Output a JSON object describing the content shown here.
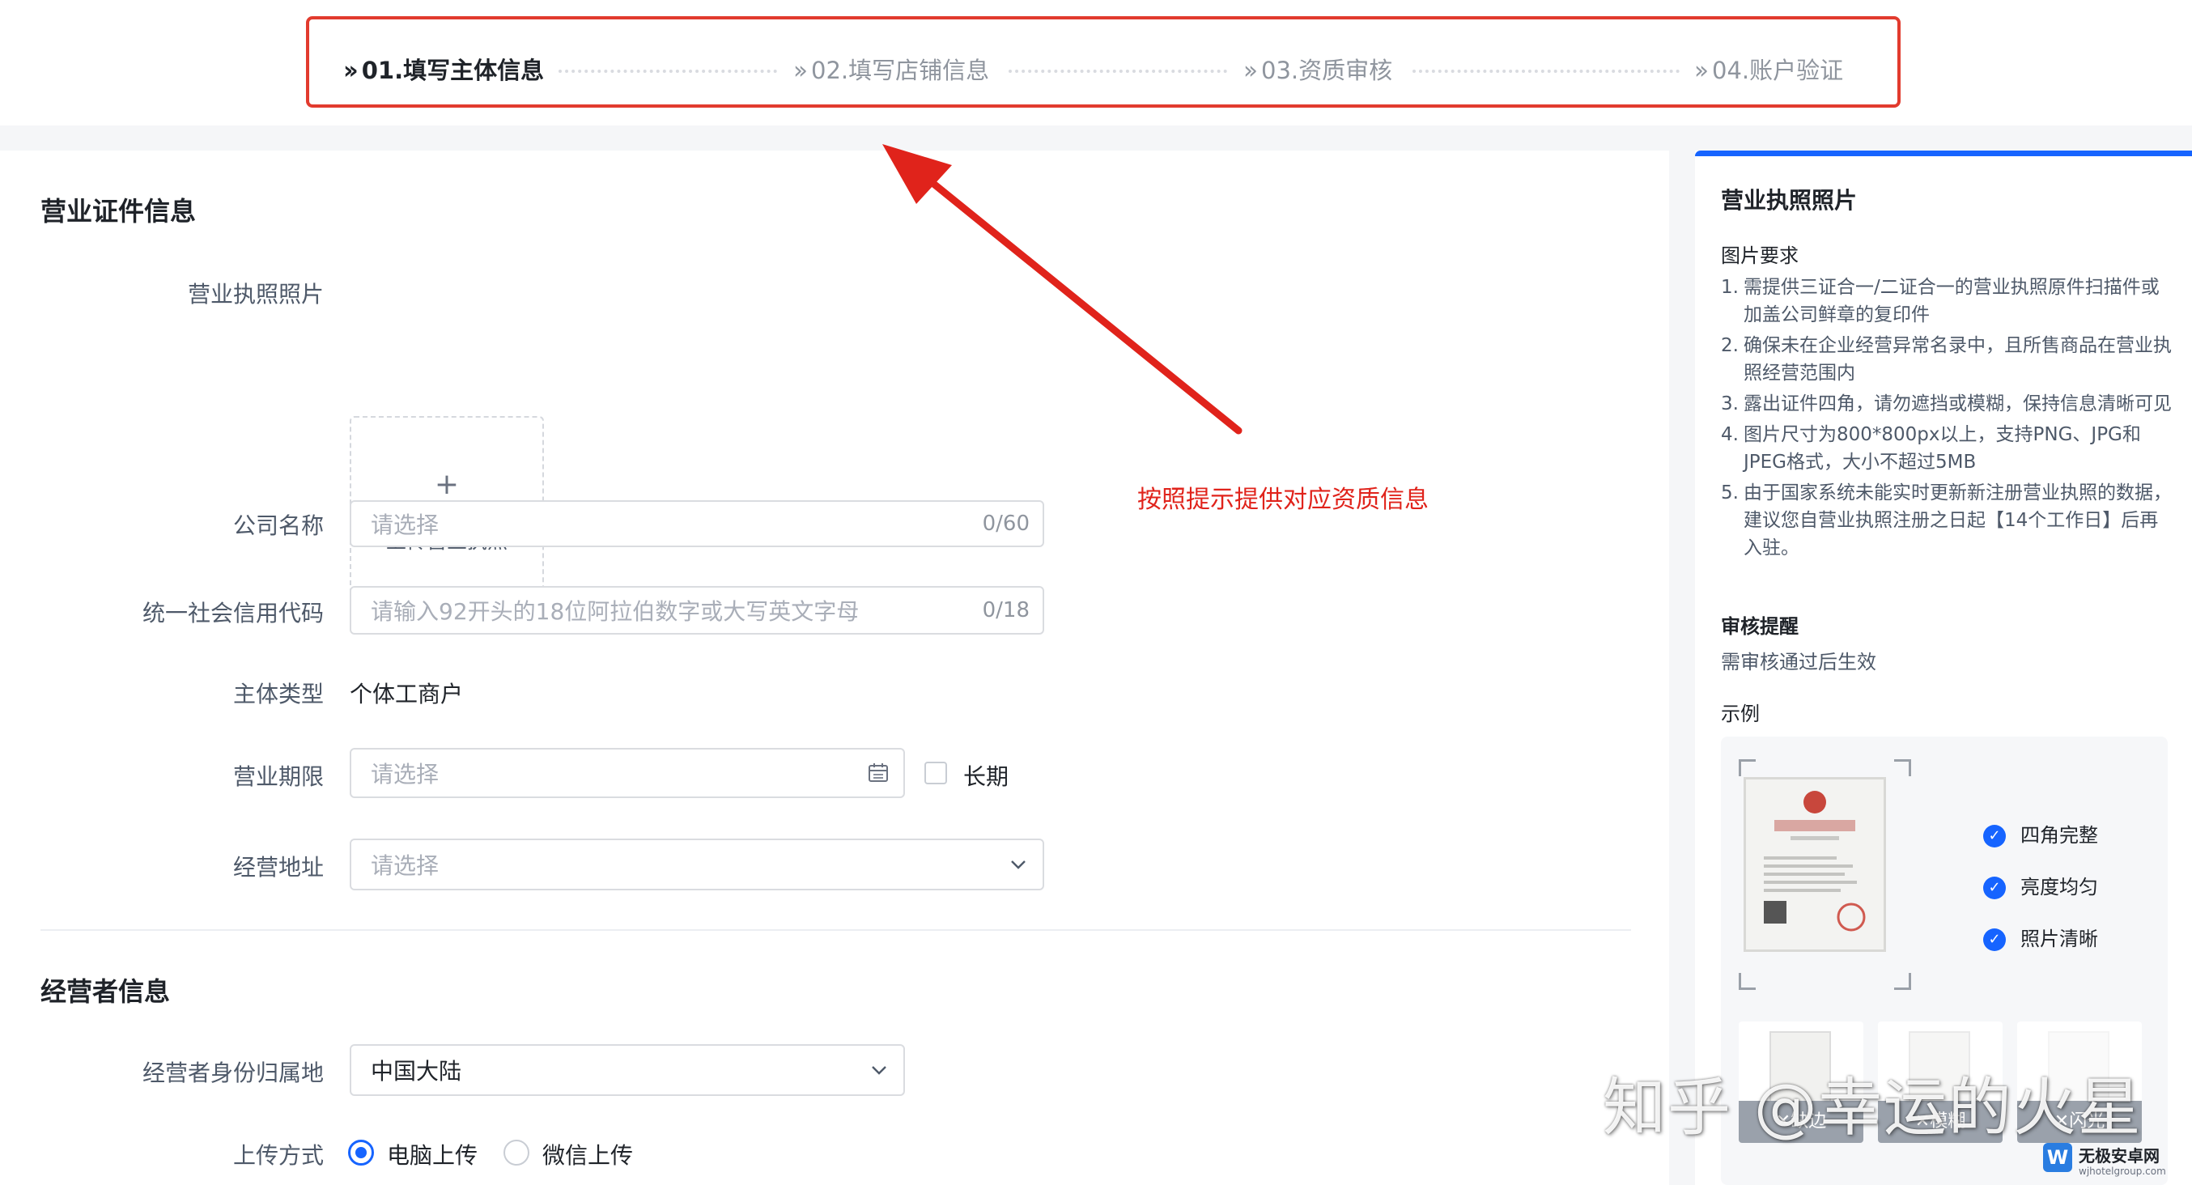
{
  "steps": [
    {
      "label": "01.填写主体信息",
      "active": true
    },
    {
      "label": "02.填写店铺信息",
      "active": false
    },
    {
      "label": "03.资质审核",
      "active": false
    },
    {
      "label": "04.账户验证",
      "active": false
    }
  ],
  "annotation": "按照提示提供对应资质信息",
  "license_section": {
    "title": "营业证件信息",
    "photo_label": "营业执照照片",
    "upload_plus": "+",
    "upload_text": "上传营业执照",
    "company_name": {
      "label": "公司名称",
      "placeholder": "请选择",
      "count": "0/60"
    },
    "credit_code": {
      "label": "统一社会信用代码",
      "placeholder": "请输入92开头的18位阿拉伯数字或大写英文字母",
      "count": "0/18"
    },
    "entity_type": {
      "label": "主体类型",
      "value": "个体工商户"
    },
    "business_term": {
      "label": "营业期限",
      "placeholder": "请选择",
      "long_term": "长期"
    },
    "address": {
      "label": "经营地址",
      "placeholder": "请选择"
    }
  },
  "operator_section": {
    "title": "经营者信息",
    "id_region": {
      "label": "经营者身份归属地",
      "value": "中国大陆"
    },
    "upload_method": {
      "label": "上传方式",
      "options": [
        "电脑上传",
        "微信上传"
      ],
      "selected": "电脑上传"
    }
  },
  "side": {
    "title": "营业执照照片",
    "req_title": "图片要求",
    "requirements": [
      "需提供三证合一/二证合一的营业执照原件扫描件或加盖公司鲜章的复印件",
      "确保未在企业经营异常名录中，且所售商品在营业执照经营范围内",
      "露出证件四角，请勿遮挡或模糊，保持信息清晰可见",
      "图片尺寸为800*800px以上，支持PNG、JPG和JPEG格式，大小不超过5MB",
      "由于国家系统未能实时更新新注册营业执照的数据，建议您自营业执照注册之日起【14个工作日】后再入驻。"
    ],
    "review_title": "审核提醒",
    "review_text": "需审核通过后生效",
    "example_title": "示例",
    "checks": [
      "四角完整",
      "亮度均匀",
      "照片清晰"
    ],
    "thumbs": [
      "✕缺边",
      "✕模糊",
      "✕闪光"
    ]
  },
  "watermark": {
    "text": "知乎 @幸运的火星",
    "site": "无极安卓网",
    "url": "wjhotelgroup.com"
  },
  "colors": {
    "accent": "#1664ff",
    "annotation": "#e0231b",
    "frame": "#e23b2e"
  }
}
